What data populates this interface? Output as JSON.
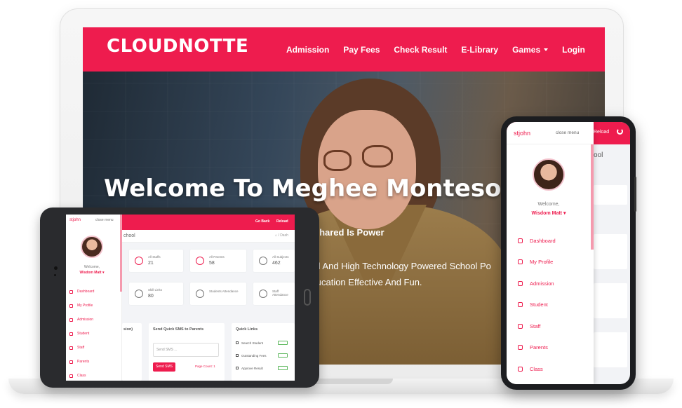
{
  "laptop": {
    "brand": "CLOUDNOTTE",
    "nav": [
      {
        "label": "Admission"
      },
      {
        "label": "Pay Fees"
      },
      {
        "label": "Check Result"
      },
      {
        "label": "E-Library"
      },
      {
        "label": "Games"
      },
      {
        "label": "Login"
      }
    ],
    "hero": {
      "title": "Welcome To Meghee Montesorri",
      "subtitle": "lge Shared Is Power",
      "text_line1": "ented And High Technology Powered School Po",
      "text_line2": "d Education Effective And Fun."
    }
  },
  "tablet": {
    "brand": "stjohn",
    "close_menu": "close menu",
    "welcome": "Welcome,",
    "user": "Wisdom Matt ▾",
    "menu": [
      "Dashboard",
      "My Profile",
      "Admission",
      "Student",
      "Staff",
      "Parents",
      "Class"
    ],
    "go_back": "Go Back",
    "reload": "Reload",
    "page_title": "chool",
    "breadcrumb": "⌂ / Dash",
    "cards": [
      {
        "label": "All Staffs",
        "value": "21"
      },
      {
        "label": "All Parents",
        "value": "58"
      },
      {
        "label": "All Subjects",
        "value": "462"
      },
      {
        "label": "Skill Links",
        "value": "80"
      },
      {
        "label": "Students Attendance",
        "value": ""
      },
      {
        "label": "Staff Attendance",
        "value": ""
      }
    ],
    "panel_left_title": "sion)",
    "sms": {
      "title": "Send Quick SMS to Parents",
      "placeholder": "Send SMS ...",
      "button": "Send SMS",
      "page_count": "Page Count: 1"
    },
    "quick_links": {
      "title": "Quick Links",
      "items": [
        "Search Student",
        "Outstanding Fees",
        "Approve Result"
      ]
    }
  },
  "phone": {
    "brand": "stjohn",
    "close_menu": "close menu",
    "reload": "Reload",
    "page_title": "ool",
    "welcome": "Welcome,",
    "user": "Wisdom Matt ▾",
    "menu": [
      "Dashboard",
      "My Profile",
      "Admission",
      "Student",
      "Staff",
      "Parents",
      "Class"
    ]
  },
  "colors": {
    "accent": "#ee1c4e",
    "device_frame": "#2a2b2e"
  }
}
